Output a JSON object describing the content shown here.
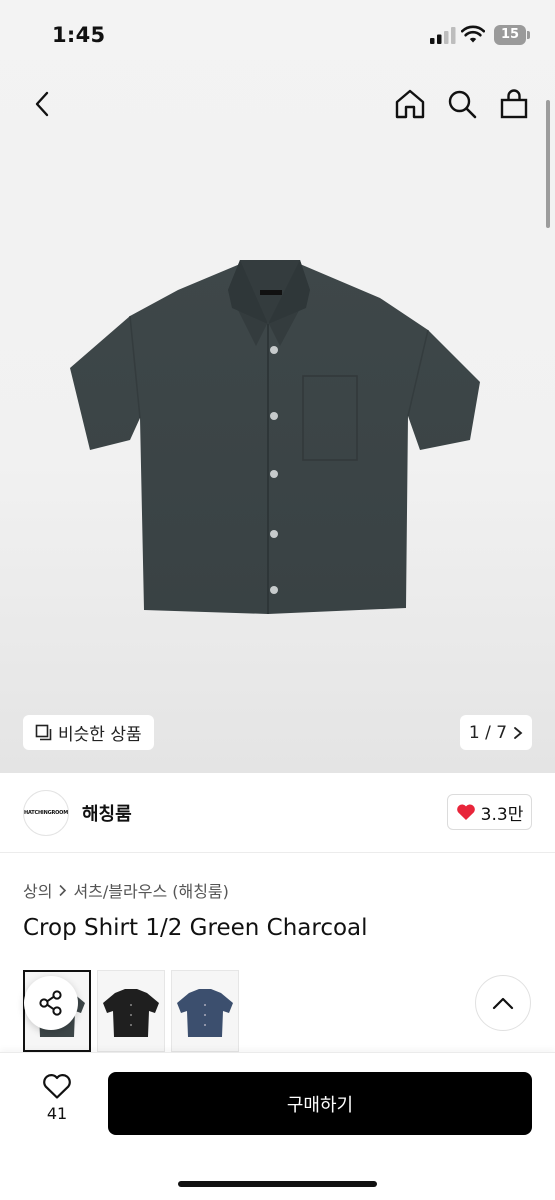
{
  "status_bar": {
    "time": "1:45",
    "battery": "15"
  },
  "nav": {
    "back": "back-icon",
    "home": "home-icon",
    "search": "search-icon",
    "bag": "bag-icon"
  },
  "gallery": {
    "similar_label": "비슷한 상품",
    "counter": "1 / 7"
  },
  "brand": {
    "name": "해칭룸",
    "logo_text": "HATCHINGROOM",
    "like_count": "3.3만"
  },
  "breadcrumb": {
    "category": "상의",
    "subcategory": "셔츠/블라우스 (해칭룸)"
  },
  "product": {
    "title": "Crop Shirt 1/2 Green Charcoal"
  },
  "thumbnails": [
    {
      "color": "#3d4648"
    },
    {
      "color": "#1f1f1f"
    },
    {
      "color": "#3c4f6e"
    }
  ],
  "bottom": {
    "wish_count": "41",
    "buy_label": "구매하기"
  },
  "colors": {
    "accent_heart": "#e8253a",
    "buy_button": "#000000"
  }
}
